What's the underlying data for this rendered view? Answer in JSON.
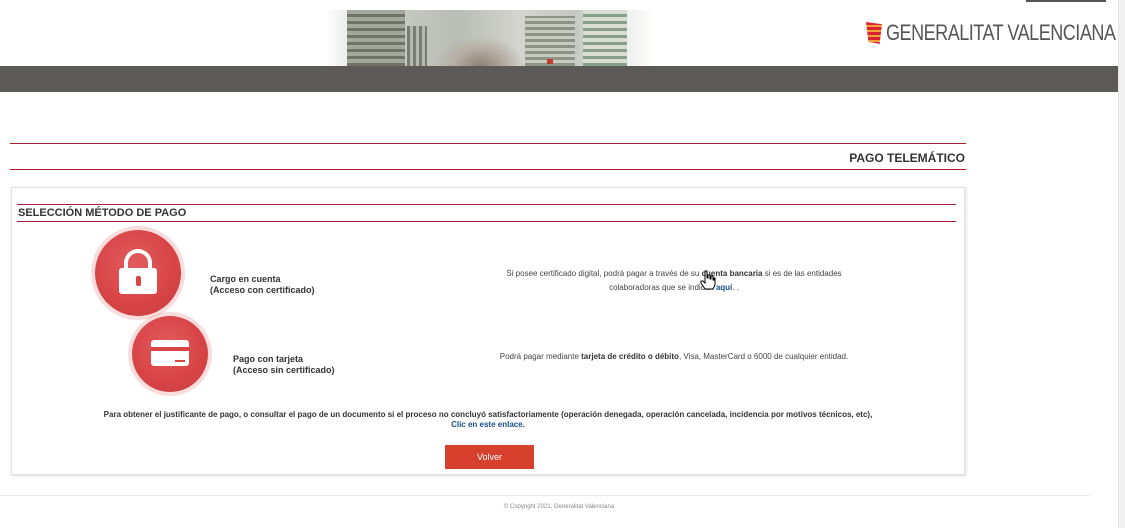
{
  "header": {
    "logo_text": "GENERALITAT VALENCIANA",
    "logo_icon": "generalitat-flag-icon"
  },
  "page": {
    "title": "PAGO TELEMÁTICO",
    "section_title": "SELECCIÓN MÉTODO DE PAGO"
  },
  "options": [
    {
      "icon": "lock-icon",
      "label_line1": "Cargo en cuenta",
      "label_line2": "(Acceso con certificado)",
      "desc_part1": "Si posee certificado digital, podrá pagar a través de su ",
      "desc_bold": "cuenta bancaria",
      "desc_part2": " si es de las entidades",
      "desc_part3": "colaboradoras que se indican ",
      "desc_link": "aquí",
      "desc_part4": ". ."
    },
    {
      "icon": "credit-card-icon",
      "label_line1": "Pago con tarjeta",
      "label_line2": "(Acceso sin certificado)",
      "desc_part1": "Podrá pagar mediante ",
      "desc_bold": "tarjeta de crédito o débito",
      "desc_part2": ", Visa, MasterCard o 6000 de cualquier entidad."
    }
  ],
  "notice": {
    "text": "Para obtener el justificante de pago, o consultar el pago de un documento si el proceso no concluyó satisfactoriamente (operación denegada, operación cancelada, incidencia por motivos técnicos, etc),",
    "link": "Clic en este enlace."
  },
  "buttons": {
    "back": "Volver"
  },
  "footer": {
    "copyright": "© Copyright 2021, Generalitat Valenciana"
  },
  "colors": {
    "accent": "#a51d35",
    "button": "#d8402e",
    "circle": "#d84547",
    "bar": "#5b5a59",
    "link": "#1b4f8a"
  }
}
